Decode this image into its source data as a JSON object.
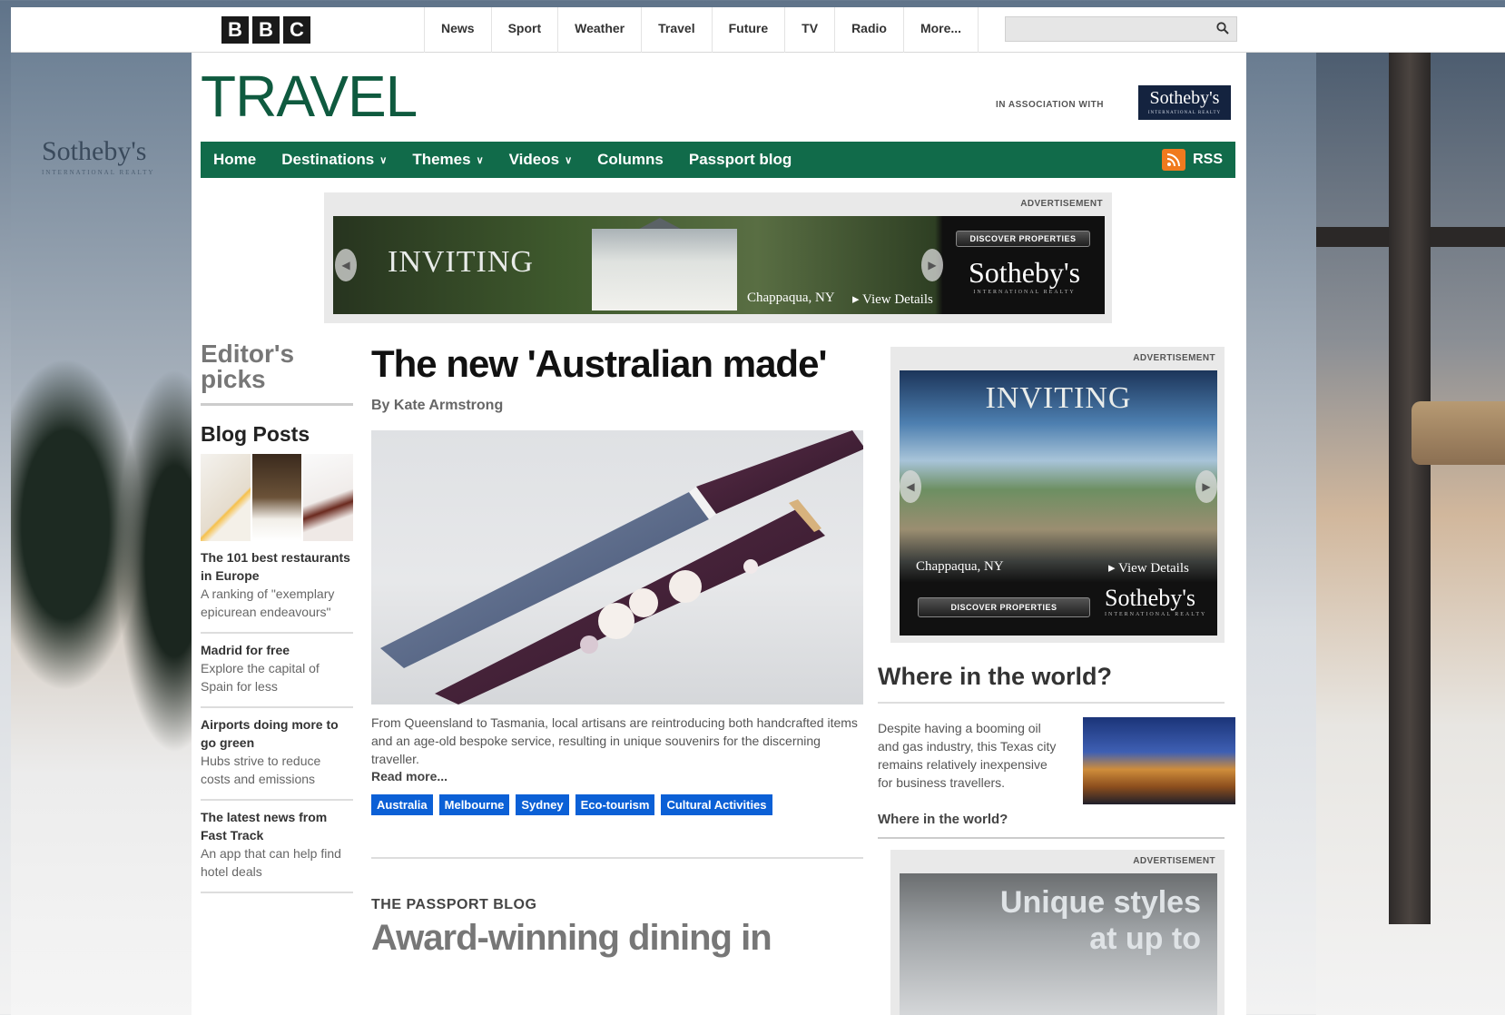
{
  "topbar": {
    "logo_letters": [
      "B",
      "B",
      "C"
    ],
    "nav": [
      "News",
      "Sport",
      "Weather",
      "Travel",
      "Future",
      "TV",
      "Radio",
      "More..."
    ],
    "search_placeholder": ""
  },
  "skin": {
    "brand": "Sotheby's",
    "brand_sub": "INTERNATIONAL REALTY"
  },
  "header": {
    "title": "TRAVEL",
    "assoc_text": "IN ASSOCIATION WITH",
    "sponsor": "Sotheby's",
    "sponsor_sub": "INTERNATIONAL REALTY"
  },
  "greennav": {
    "items": [
      {
        "label": "Home",
        "dropdown": false
      },
      {
        "label": "Destinations",
        "dropdown": true
      },
      {
        "label": "Themes",
        "dropdown": true
      },
      {
        "label": "Videos",
        "dropdown": true
      },
      {
        "label": "Columns",
        "dropdown": false
      },
      {
        "label": "Passport blog",
        "dropdown": false
      }
    ],
    "rss": "RSS",
    "color": "#116b4a"
  },
  "top_ad": {
    "label": "ADVERTISEMENT",
    "headline": "INVITING",
    "caption": "Chappaqua, NY",
    "details": "▸ View Details",
    "button": "DISCOVER PROPERTIES",
    "brand": "Sotheby's",
    "brand_sub": "INTERNATIONAL REALTY"
  },
  "leftcol": {
    "editors_picks": "Editor's picks",
    "blog_posts": "Blog Posts",
    "items": [
      {
        "title": "The 101 best restaurants in Europe",
        "desc": "A ranking of \"exemplary epicurean endeavours\""
      },
      {
        "title": "Madrid for free",
        "desc": "Explore the capital of Spain for less"
      },
      {
        "title": "Airports doing more to go green",
        "desc": "Hubs strive to reduce costs and emissions"
      },
      {
        "title": "The latest news from Fast Track",
        "desc": "An app that can help find hotel deals"
      }
    ]
  },
  "article": {
    "headline": "The new 'Australian made'",
    "byline": "By Kate Armstrong",
    "summary": "From Queensland to Tasmania, local artisans are reintroducing both handcrafted items and an age-old bespoke service, resulting in unique souvenirs for the discerning traveller.",
    "read_more": "Read more...",
    "tags": [
      "Australia",
      "Melbourne",
      "Sydney",
      "Eco-tourism",
      "Cultural Activities"
    ],
    "tag_color": "#0b60d6"
  },
  "passport": {
    "label": "THE PASSPORT BLOG",
    "headline": "Award-winning dining in"
  },
  "side_ad": {
    "label": "ADVERTISEMENT",
    "headline": "INVITING",
    "caption": "Chappaqua, NY",
    "details": "▸ View Details",
    "button": "DISCOVER PROPERTIES",
    "brand": "Sotheby's",
    "brand_sub": "INTERNATIONAL REALTY"
  },
  "where": {
    "heading": "Where in the world?",
    "text": "Despite having a booming oil and gas industry, this Texas city remains relatively inexpensive for business travellers.",
    "link": "Where in the world?"
  },
  "side_ad2": {
    "label": "ADVERTISEMENT",
    "line1": "Unique styles",
    "line2": "at up to"
  }
}
